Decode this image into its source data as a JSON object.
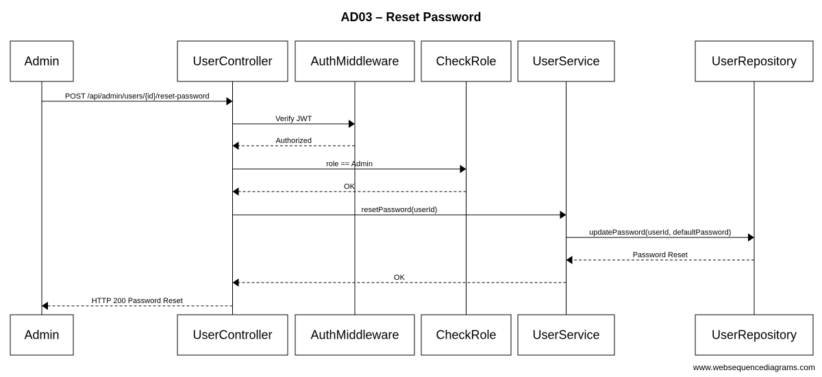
{
  "title": "AD03 – Reset Password",
  "participants": [
    {
      "id": "admin",
      "label": "Admin"
    },
    {
      "id": "usercontroller",
      "label": "UserController"
    },
    {
      "id": "authmiddleware",
      "label": "AuthMiddleware"
    },
    {
      "id": "checkrole",
      "label": "CheckRole"
    },
    {
      "id": "userservice",
      "label": "UserService"
    },
    {
      "id": "userrepository",
      "label": "UserRepository"
    }
  ],
  "messages": [
    {
      "from": "admin",
      "to": "usercontroller",
      "label": "POST /api/admin/users/{id}/reset-password",
      "style": "solid"
    },
    {
      "from": "usercontroller",
      "to": "authmiddleware",
      "label": "Verify JWT",
      "style": "solid"
    },
    {
      "from": "authmiddleware",
      "to": "usercontroller",
      "label": "Authorized",
      "style": "dashed"
    },
    {
      "from": "usercontroller",
      "to": "checkrole",
      "label": "role == Admin",
      "style": "solid"
    },
    {
      "from": "checkrole",
      "to": "usercontroller",
      "label": "OK",
      "style": "dashed"
    },
    {
      "from": "usercontroller",
      "to": "userservice",
      "label": "resetPassword(userId)",
      "style": "solid"
    },
    {
      "from": "userservice",
      "to": "userrepository",
      "label": "updatePassword(userId, defaultPassword)",
      "style": "solid"
    },
    {
      "from": "userrepository",
      "to": "userservice",
      "label": "Password Reset",
      "style": "dashed"
    },
    {
      "from": "userservice",
      "to": "usercontroller",
      "label": "OK",
      "style": "dashed"
    },
    {
      "from": "usercontroller",
      "to": "admin",
      "label": "HTTP 200 Password Reset",
      "style": "dashed"
    }
  ],
  "watermark": "www.websequencediagrams.com"
}
